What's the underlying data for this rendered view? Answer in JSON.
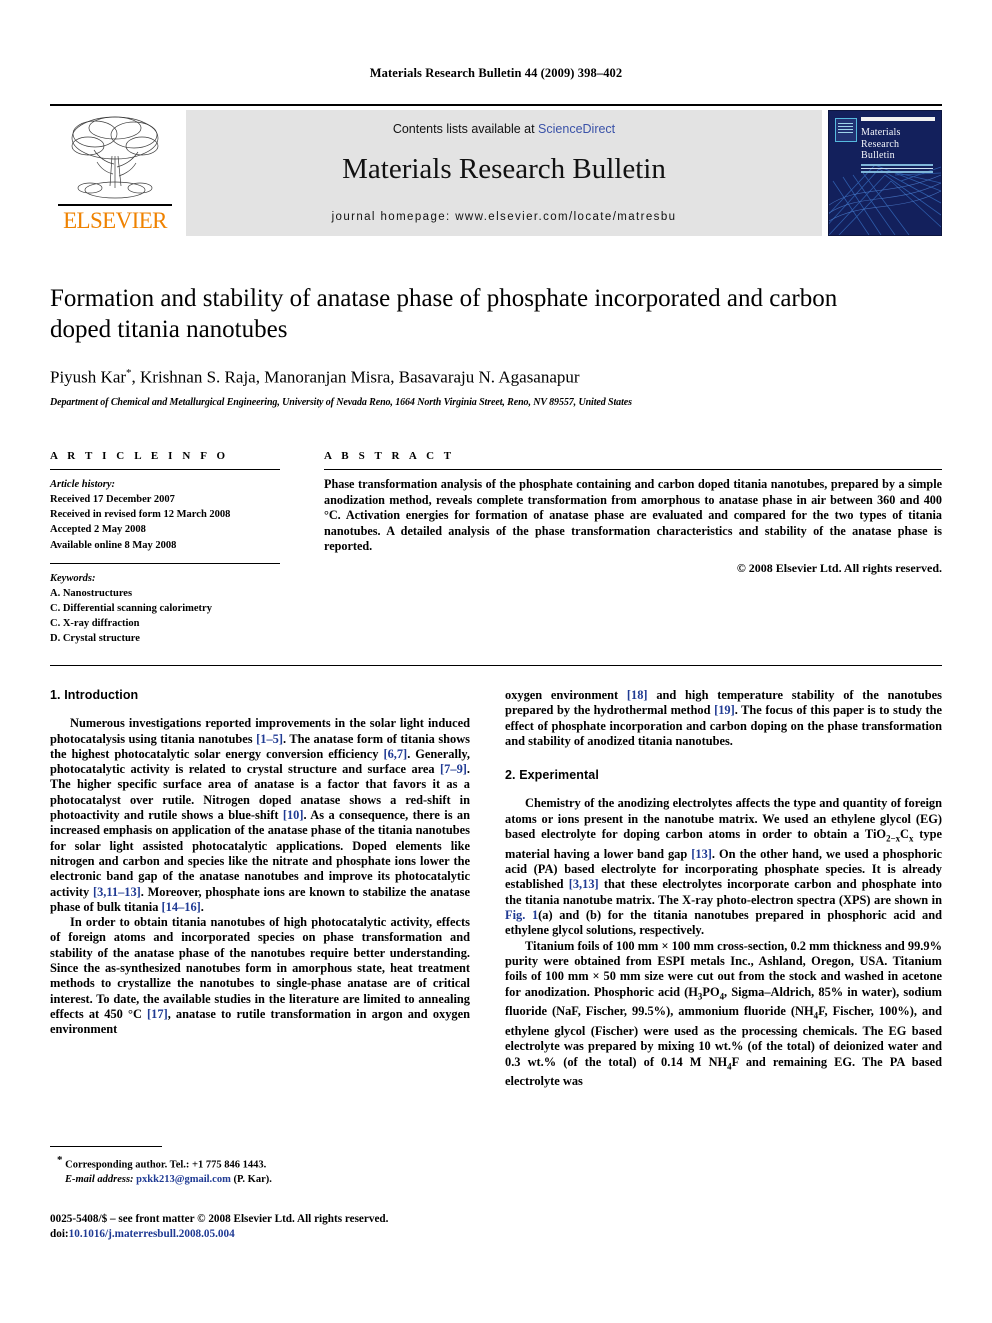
{
  "running_head": "Materials Research Bulletin 44 (2009) 398–402",
  "masthead": {
    "publisher_wordmark": "ELSEVIER",
    "contents_prefix": "Contents lists available at ",
    "contents_link": "ScienceDirect",
    "journal_title": "Materials Research Bulletin",
    "homepage_line": "journal homepage: www.elsevier.com/locate/matresbu",
    "cover_title_line1": "Materials",
    "cover_title_line2": "Research",
    "cover_title_line3": "Bulletin"
  },
  "article": {
    "title": "Formation and stability of anatase phase of phosphate incorporated and carbon doped titania nanotubes",
    "authors": "Piyush Kar",
    "authors_rest": ", Krishnan S. Raja, Manoranjan Misra, Basavaraju N. Agasanapur",
    "corresponding_marker": "*",
    "affiliation": "Department of Chemical and Metallurgical Engineering, University of Nevada Reno, 1664 North Virginia Street, Reno, NV 89557, United States"
  },
  "article_info": {
    "heading": "A R T I C L E   I N F O",
    "history_label": "Article history:",
    "history": [
      "Received 17 December 2007",
      "Received in revised form 12 March 2008",
      "Accepted 2 May 2008",
      "Available online 8 May 2008"
    ],
    "keywords_label": "Keywords:",
    "keywords": [
      "A. Nanostructures",
      "C. Differential scanning calorimetry",
      "C. X-ray diffraction",
      "D. Crystal structure"
    ]
  },
  "abstract": {
    "heading": "A B S T R A C T",
    "text": "Phase transformation analysis of the phosphate containing and carbon doped titania nanotubes, prepared by a simple anodization method, reveals complete transformation from amorphous to anatase phase in air between 360 and 400 °C. Activation energies for formation of anatase phase are evaluated and compared for the two types of titania nanotubes. A detailed analysis of the phase transformation characteristics and stability of the anatase phase is reported.",
    "copyright": "© 2008 Elsevier Ltd. All rights reserved."
  },
  "sections": {
    "introduction_heading": "1. Introduction",
    "intro_p1_a": "Numerous investigations reported improvements in the solar light induced photocatalysis using titania nanotubes ",
    "intro_p1_ref1": "[1–5]",
    "intro_p1_b": ". The anatase form of titania shows the highest photocatalytic solar energy conversion efficiency ",
    "intro_p1_ref2": "[6,7]",
    "intro_p1_c": ". Generally, photocatalytic activity is related to crystal structure and surface area ",
    "intro_p1_ref3": "[7–9]",
    "intro_p1_d": ". The higher specific surface area of anatase is a factor that favors it as a photocatalyst over rutile. Nitrogen doped anatase shows a red-shift in photoactivity and rutile shows a blue-shift ",
    "intro_p1_ref4": "[10]",
    "intro_p1_e": ". As a consequence, there is an increased emphasis on application of the anatase phase of the titania nanotubes for solar light assisted photocatalytic applications. Doped elements like nitrogen and carbon and species like the nitrate and phosphate ions lower the electronic band gap of the anatase nanotubes and improve its photocatalytic activity ",
    "intro_p1_ref5": "[3,11–13]",
    "intro_p1_f": ". Moreover, phosphate ions are known to stabilize the anatase phase of bulk titania ",
    "intro_p1_ref6": "[14–16]",
    "intro_p1_g": ".",
    "intro_p2_a": "In order to obtain titania nanotubes of high photocatalytic activity, effects of foreign atoms and incorporated species on phase transformation and stability of the anatase phase of the nanotubes require better understanding. Since the as-synthesized nanotubes form in amorphous state, heat treatment methods to crystallize the nanotubes to single-phase anatase are of critical interest. To date, the available studies in the literature are limited to annealing effects at 450 °C ",
    "intro_p2_ref1": "[17]",
    "intro_p2_b": ", anatase to rutile transformation in argon and oxygen environment ",
    "intro_p2_ref2": "[18]",
    "intro_p2_c": " and high temperature stability of the nanotubes prepared by the hydrothermal method ",
    "intro_p2_ref3": "[19]",
    "intro_p2_d": ". The focus of this paper is to study the effect of phosphate incorporation and carbon doping on the phase transformation and stability of anodized titania nanotubes.",
    "experimental_heading": "2. Experimental",
    "exp_p1_a": "Chemistry of the anodizing electrolytes affects the type and quantity of foreign atoms or ions present in the nanotube matrix. We used an ethylene glycol (EG) based electrolyte for doping carbon atoms in order to obtain a TiO",
    "exp_p1_formula_sub1": "2−x",
    "exp_p1_formula_c": "C",
    "exp_p1_formula_sub2": "x",
    "exp_p1_b": " type material having a lower band gap ",
    "exp_p1_ref1": "[13]",
    "exp_p1_c": ". On the other hand, we used a phosphoric acid (PA) based electrolyte for incorporating phosphate species. It is already established ",
    "exp_p1_ref2": "[3,13]",
    "exp_p1_d": " that these electrolytes incorporate carbon and phosphate into the titania nanotube matrix. The X-ray photo-electron spectra (XPS) are shown in ",
    "exp_p1_figref": "Fig. 1",
    "exp_p1_e": "(a) and (b) for the titania nanotubes prepared in phosphoric acid and ethylene glycol solutions, respectively.",
    "exp_p2_a": "Titanium foils of 100 mm × 100 mm cross-section, 0.2 mm thickness and 99.9% purity were obtained from ESPI metals Inc., Ashland, Oregon, USA. Titanium foils of 100 mm × 50 mm size were cut out from the stock and washed in acetone for anodization. Phosphoric acid (H",
    "exp_p2_sub1": "3",
    "exp_p2_b": "PO",
    "exp_p2_sub2": "4",
    "exp_p2_c": ", Sigma–Aldrich, 85% in water), sodium fluoride (NaF, Fischer, 99.5%), ammonium fluoride (NH",
    "exp_p2_sub3": "4",
    "exp_p2_d": "F, Fischer, 100%), and ethylene glycol (Fischer) were used as the processing chemicals. The EG based electrolyte was prepared by mixing 10 wt.% (of the total) of deionized water and 0.3 wt.% (of the total) of 0.14 M NH",
    "exp_p2_sub4": "4",
    "exp_p2_e": "F and remaining EG. The PA based electrolyte was"
  },
  "footnote": {
    "marker": "*",
    "corresponding": " Corresponding author. Tel.: +1 775 846 1443.",
    "email_label": "E-mail address:",
    "email": "pxkk213@gmail.com",
    "email_owner": "(P. Kar)."
  },
  "colophon": {
    "issn_line": "0025-5408/$ – see front matter © 2008 Elsevier Ltd. All rights reserved.",
    "doi_label": "doi:",
    "doi_value": "10.1016/j.materresbull.2008.05.004"
  },
  "colors": {
    "elsevier_orange": "#ef8200",
    "link_blue": "#1f3a93",
    "sciencedirect_blue": "#3a52a8",
    "band_gray": "#e3e3e3",
    "cover_navy": "#13205c"
  }
}
